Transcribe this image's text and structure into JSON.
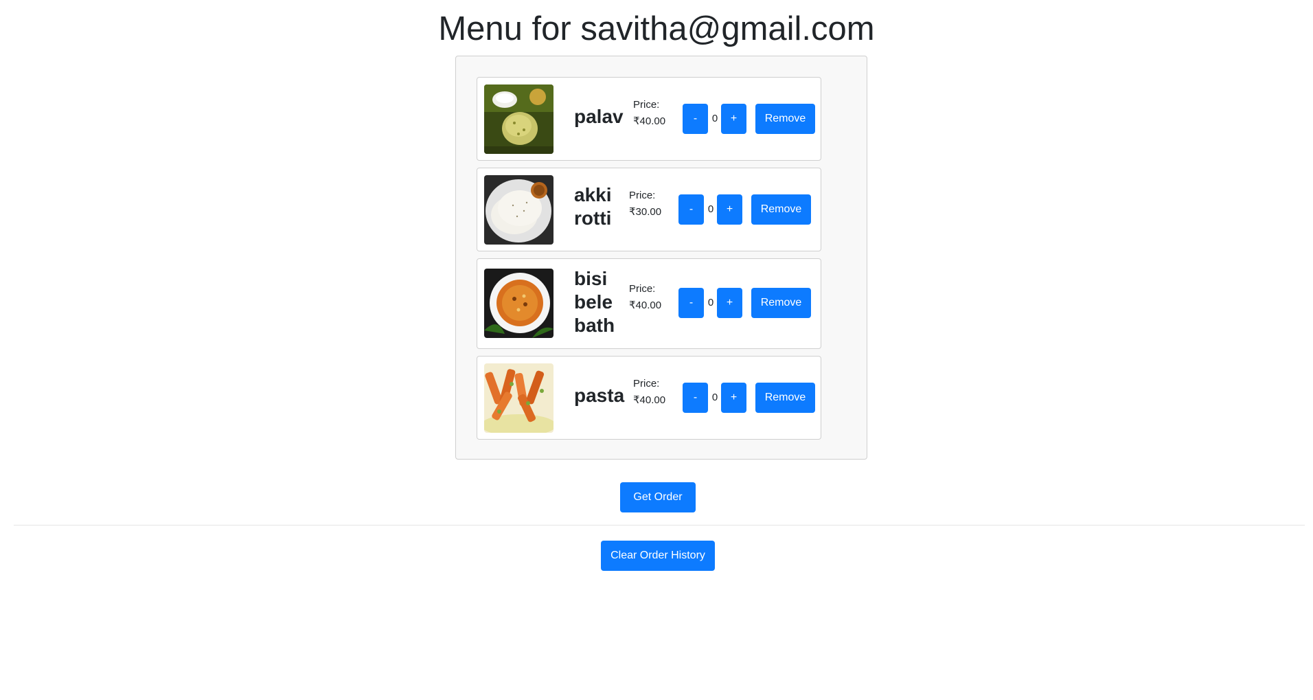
{
  "page": {
    "title": "Menu for savitha@gmail.com"
  },
  "items": [
    {
      "name": "palav",
      "price_label": "Price:",
      "price": "₹40.00",
      "qty": "0",
      "minus_label": "-",
      "plus_label": "+",
      "remove_label": "Remove"
    },
    {
      "name": "akki rotti",
      "price_label": "Price:",
      "price": "₹30.00",
      "qty": "0",
      "minus_label": "-",
      "plus_label": "+",
      "remove_label": "Remove"
    },
    {
      "name": "bisi bele bath",
      "price_label": "Price:",
      "price": "₹40.00",
      "qty": "0",
      "minus_label": "-",
      "plus_label": "+",
      "remove_label": "Remove"
    },
    {
      "name": "pasta",
      "price_label": "Price:",
      "price": "₹40.00",
      "qty": "0",
      "minus_label": "-",
      "plus_label": "+",
      "remove_label": "Remove"
    }
  ],
  "actions": {
    "get_order_label": "Get Order",
    "clear_history_label": "Clear Order History"
  },
  "colors": {
    "primary": "#0d7bff",
    "panel_bg": "#f8f8f8",
    "border": "#cfcfcf"
  }
}
